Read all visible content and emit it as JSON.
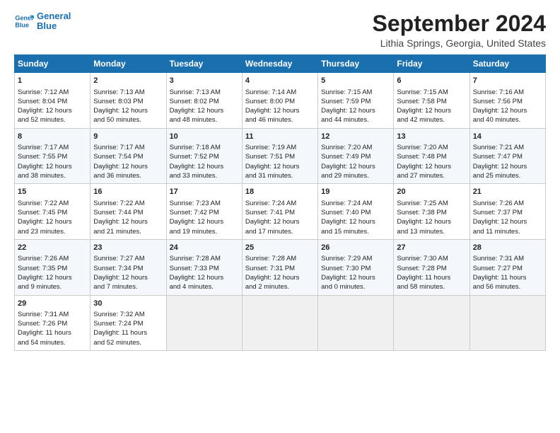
{
  "header": {
    "logo_line1": "General",
    "logo_line2": "Blue",
    "title": "September 2024",
    "subtitle": "Lithia Springs, Georgia, United States"
  },
  "days_of_week": [
    "Sunday",
    "Monday",
    "Tuesday",
    "Wednesday",
    "Thursday",
    "Friday",
    "Saturday"
  ],
  "weeks": [
    [
      {
        "day": "1",
        "lines": [
          "Sunrise: 7:12 AM",
          "Sunset: 8:04 PM",
          "Daylight: 12 hours",
          "and 52 minutes."
        ]
      },
      {
        "day": "2",
        "lines": [
          "Sunrise: 7:13 AM",
          "Sunset: 8:03 PM",
          "Daylight: 12 hours",
          "and 50 minutes."
        ]
      },
      {
        "day": "3",
        "lines": [
          "Sunrise: 7:13 AM",
          "Sunset: 8:02 PM",
          "Daylight: 12 hours",
          "and 48 minutes."
        ]
      },
      {
        "day": "4",
        "lines": [
          "Sunrise: 7:14 AM",
          "Sunset: 8:00 PM",
          "Daylight: 12 hours",
          "and 46 minutes."
        ]
      },
      {
        "day": "5",
        "lines": [
          "Sunrise: 7:15 AM",
          "Sunset: 7:59 PM",
          "Daylight: 12 hours",
          "and 44 minutes."
        ]
      },
      {
        "day": "6",
        "lines": [
          "Sunrise: 7:15 AM",
          "Sunset: 7:58 PM",
          "Daylight: 12 hours",
          "and 42 minutes."
        ]
      },
      {
        "day": "7",
        "lines": [
          "Sunrise: 7:16 AM",
          "Sunset: 7:56 PM",
          "Daylight: 12 hours",
          "and 40 minutes."
        ]
      }
    ],
    [
      {
        "day": "8",
        "lines": [
          "Sunrise: 7:17 AM",
          "Sunset: 7:55 PM",
          "Daylight: 12 hours",
          "and 38 minutes."
        ]
      },
      {
        "day": "9",
        "lines": [
          "Sunrise: 7:17 AM",
          "Sunset: 7:54 PM",
          "Daylight: 12 hours",
          "and 36 minutes."
        ]
      },
      {
        "day": "10",
        "lines": [
          "Sunrise: 7:18 AM",
          "Sunset: 7:52 PM",
          "Daylight: 12 hours",
          "and 33 minutes."
        ]
      },
      {
        "day": "11",
        "lines": [
          "Sunrise: 7:19 AM",
          "Sunset: 7:51 PM",
          "Daylight: 12 hours",
          "and 31 minutes."
        ]
      },
      {
        "day": "12",
        "lines": [
          "Sunrise: 7:20 AM",
          "Sunset: 7:49 PM",
          "Daylight: 12 hours",
          "and 29 minutes."
        ]
      },
      {
        "day": "13",
        "lines": [
          "Sunrise: 7:20 AM",
          "Sunset: 7:48 PM",
          "Daylight: 12 hours",
          "and 27 minutes."
        ]
      },
      {
        "day": "14",
        "lines": [
          "Sunrise: 7:21 AM",
          "Sunset: 7:47 PM",
          "Daylight: 12 hours",
          "and 25 minutes."
        ]
      }
    ],
    [
      {
        "day": "15",
        "lines": [
          "Sunrise: 7:22 AM",
          "Sunset: 7:45 PM",
          "Daylight: 12 hours",
          "and 23 minutes."
        ]
      },
      {
        "day": "16",
        "lines": [
          "Sunrise: 7:22 AM",
          "Sunset: 7:44 PM",
          "Daylight: 12 hours",
          "and 21 minutes."
        ]
      },
      {
        "day": "17",
        "lines": [
          "Sunrise: 7:23 AM",
          "Sunset: 7:42 PM",
          "Daylight: 12 hours",
          "and 19 minutes."
        ]
      },
      {
        "day": "18",
        "lines": [
          "Sunrise: 7:24 AM",
          "Sunset: 7:41 PM",
          "Daylight: 12 hours",
          "and 17 minutes."
        ]
      },
      {
        "day": "19",
        "lines": [
          "Sunrise: 7:24 AM",
          "Sunset: 7:40 PM",
          "Daylight: 12 hours",
          "and 15 minutes."
        ]
      },
      {
        "day": "20",
        "lines": [
          "Sunrise: 7:25 AM",
          "Sunset: 7:38 PM",
          "Daylight: 12 hours",
          "and 13 minutes."
        ]
      },
      {
        "day": "21",
        "lines": [
          "Sunrise: 7:26 AM",
          "Sunset: 7:37 PM",
          "Daylight: 12 hours",
          "and 11 minutes."
        ]
      }
    ],
    [
      {
        "day": "22",
        "lines": [
          "Sunrise: 7:26 AM",
          "Sunset: 7:35 PM",
          "Daylight: 12 hours",
          "and 9 minutes."
        ]
      },
      {
        "day": "23",
        "lines": [
          "Sunrise: 7:27 AM",
          "Sunset: 7:34 PM",
          "Daylight: 12 hours",
          "and 7 minutes."
        ]
      },
      {
        "day": "24",
        "lines": [
          "Sunrise: 7:28 AM",
          "Sunset: 7:33 PM",
          "Daylight: 12 hours",
          "and 4 minutes."
        ]
      },
      {
        "day": "25",
        "lines": [
          "Sunrise: 7:28 AM",
          "Sunset: 7:31 PM",
          "Daylight: 12 hours",
          "and 2 minutes."
        ]
      },
      {
        "day": "26",
        "lines": [
          "Sunrise: 7:29 AM",
          "Sunset: 7:30 PM",
          "Daylight: 12 hours",
          "and 0 minutes."
        ]
      },
      {
        "day": "27",
        "lines": [
          "Sunrise: 7:30 AM",
          "Sunset: 7:28 PM",
          "Daylight: 11 hours",
          "and 58 minutes."
        ]
      },
      {
        "day": "28",
        "lines": [
          "Sunrise: 7:31 AM",
          "Sunset: 7:27 PM",
          "Daylight: 11 hours",
          "and 56 minutes."
        ]
      }
    ],
    [
      {
        "day": "29",
        "lines": [
          "Sunrise: 7:31 AM",
          "Sunset: 7:26 PM",
          "Daylight: 11 hours",
          "and 54 minutes."
        ]
      },
      {
        "day": "30",
        "lines": [
          "Sunrise: 7:32 AM",
          "Sunset: 7:24 PM",
          "Daylight: 11 hours",
          "and 52 minutes."
        ]
      },
      {
        "day": "",
        "lines": []
      },
      {
        "day": "",
        "lines": []
      },
      {
        "day": "",
        "lines": []
      },
      {
        "day": "",
        "lines": []
      },
      {
        "day": "",
        "lines": []
      }
    ]
  ]
}
